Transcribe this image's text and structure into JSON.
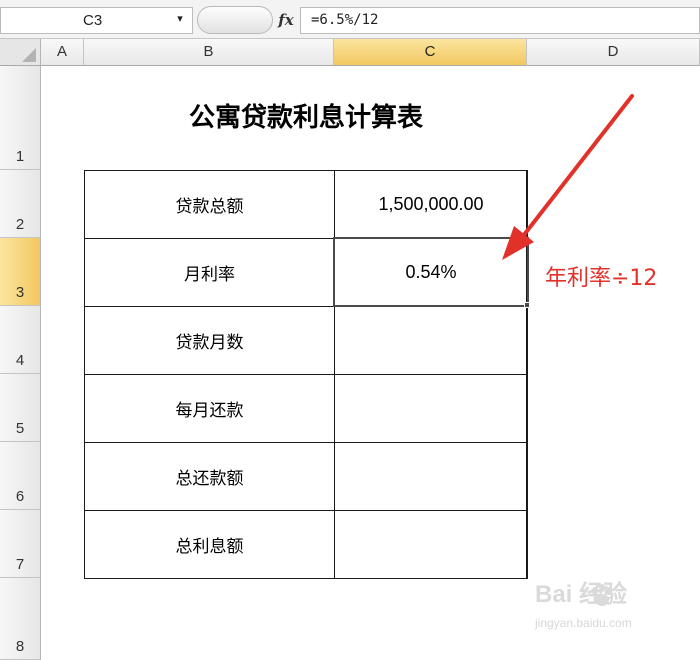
{
  "formula_bar": {
    "name_box": "C3",
    "dropdown_glyph": "▾",
    "fx_label": "fx",
    "formula": "=6.5%/12"
  },
  "columns": [
    "A",
    "B",
    "C",
    "D"
  ],
  "active_column": "C",
  "rows": [
    "1",
    "2",
    "3",
    "4",
    "5",
    "6",
    "7",
    "8"
  ],
  "active_row": "3",
  "sheet": {
    "title": "公寓贷款利息计算表",
    "table": [
      {
        "label": "贷款总额",
        "value": "1,500,000.00"
      },
      {
        "label": "月利率",
        "value": "0.54%"
      },
      {
        "label": "贷款月数",
        "value": ""
      },
      {
        "label": "每月还款",
        "value": ""
      },
      {
        "label": "总还款额",
        "value": ""
      },
      {
        "label": "总利息额",
        "value": ""
      }
    ],
    "selected_cell": "C3"
  },
  "annotation": {
    "text": "年利率÷12",
    "color": "#e23129"
  },
  "watermark": {
    "logo": "Bai  经验",
    "url": "jingyan.baidu.com"
  },
  "colors": {
    "header_active": "#f2c85f",
    "grid_line": "#1a1a1a",
    "annotation": "#e23129"
  }
}
